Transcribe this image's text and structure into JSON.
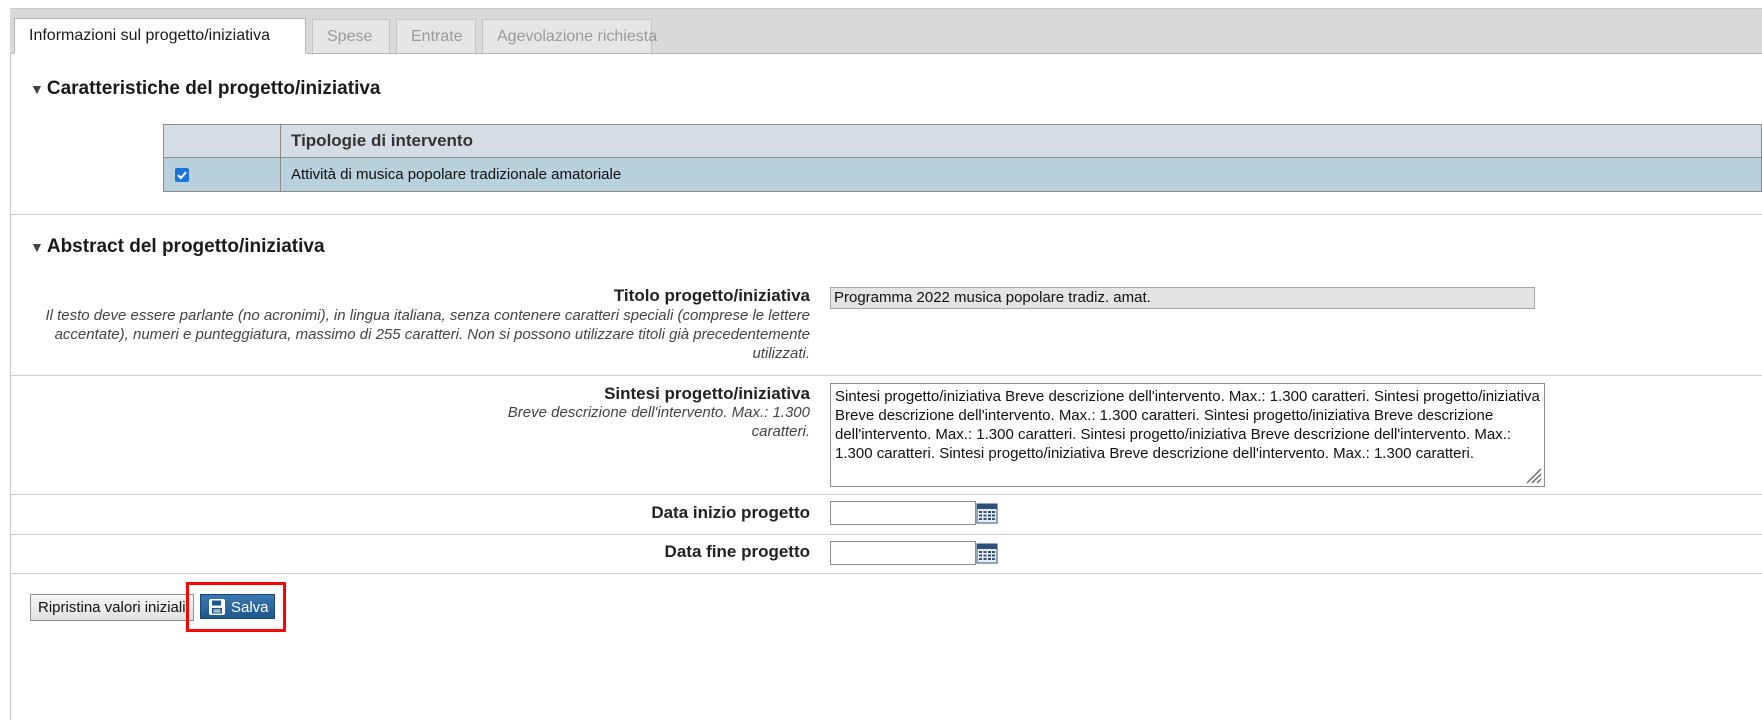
{
  "tabs": [
    {
      "label": "Informazioni sul progetto/iniziativa",
      "active": true
    },
    {
      "label": "Spese",
      "active": false
    },
    {
      "label": "Entrate",
      "active": false
    },
    {
      "label": "Agevolazione richiesta",
      "active": false
    }
  ],
  "section1": {
    "title": "Caratteristiche del progetto/iniziativa",
    "table": {
      "header": "Tipologie di intervento",
      "rows": [
        {
          "checked": true,
          "label": "Attività di musica popolare tradizionale amatoriale"
        }
      ]
    }
  },
  "section2": {
    "title": "Abstract del progetto/iniziativa",
    "titolo": {
      "label": "Titolo progetto/iniziativa",
      "help": "Il testo deve essere parlante (no acronimi), in lingua italiana, senza contenere caratteri speciali (comprese le lettere accentate), numeri e punteggiatura, massimo di 255 caratteri. Non si possono utilizzare titoli già precedentemente utilizzati.",
      "value": "Programma 2022 musica popolare tradiz. amat."
    },
    "sintesi": {
      "label": "Sintesi progetto/iniziativa",
      "help": "Breve descrizione dell'intervento. Max.: 1.300 caratteri.",
      "value": "Sintesi progetto/iniziativa Breve descrizione dell'intervento. Max.: 1.300 caratteri. Sintesi progetto/iniziativa Breve descrizione dell'intervento. Max.: 1.300 caratteri. Sintesi progetto/iniziativa Breve descrizione dell'intervento. Max.: 1.300 caratteri. Sintesi progetto/iniziativa Breve descrizione dell'intervento. Max.: 1.300 caratteri. Sintesi progetto/iniziativa Breve descrizione dell'intervento. Max.: 1.300 caratteri."
    },
    "data_inizio": {
      "label": "Data inizio progetto",
      "value": ""
    },
    "data_fine": {
      "label": "Data fine progetto",
      "value": ""
    }
  },
  "buttons": {
    "reset_label": "Ripristina valori iniziali",
    "save_label": "Salva"
  },
  "colors": {
    "highlight": "#ff0000",
    "save_button": "#2a6aa3",
    "selected_row": "#b8d1dc"
  }
}
